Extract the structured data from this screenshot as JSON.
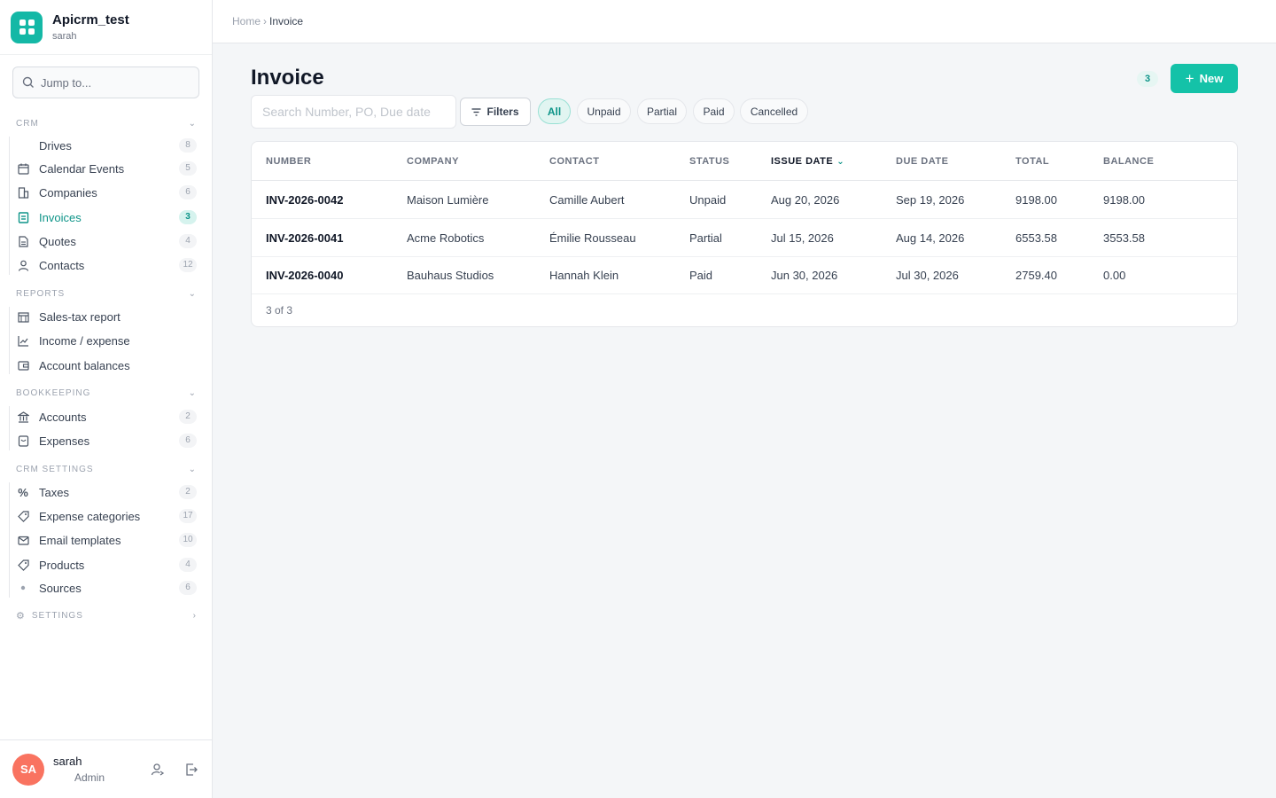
{
  "app": {
    "name": "Apicrm_test",
    "user": "sarah"
  },
  "search": {
    "placeholder": "Jump to..."
  },
  "sections": {
    "crm": "CRM",
    "reports": "REPORTS",
    "bookkeeping": "BOOKKEEPING",
    "crm_settings": "CRM SETTINGS",
    "settings": "SETTINGS"
  },
  "nav": {
    "crm": [
      {
        "label": "Drives",
        "count": "8"
      },
      {
        "label": "Calendar Events",
        "count": "5"
      },
      {
        "label": "Companies",
        "count": "6"
      },
      {
        "label": "Invoices",
        "count": "3"
      },
      {
        "label": "Quotes",
        "count": "4"
      },
      {
        "label": "Contacts",
        "count": "12"
      }
    ],
    "reports": [
      {
        "label": "Sales-tax report"
      },
      {
        "label": "Income / expense"
      },
      {
        "label": "Account balances"
      }
    ],
    "bookkeeping": [
      {
        "label": "Accounts",
        "count": "2"
      },
      {
        "label": "Expenses",
        "count": "6"
      }
    ],
    "crm_settings": [
      {
        "label": "Taxes",
        "count": "2"
      },
      {
        "label": "Expense categories",
        "count": "17"
      },
      {
        "label": "Email templates",
        "count": "10"
      },
      {
        "label": "Products",
        "count": "4"
      },
      {
        "label": "Sources",
        "count": "6"
      }
    ]
  },
  "footer": {
    "initials": "SA",
    "name": "sarah",
    "role": "Admin"
  },
  "breadcrumb": {
    "home": "Home",
    "separator": "›",
    "current": "Invoice"
  },
  "page": {
    "title": "Invoice",
    "count": "3",
    "new_label": "New"
  },
  "filters": {
    "search_placeholder": "Search Number, PO, Due date",
    "filters_label": "Filters",
    "chips": [
      "All",
      "Unpaid",
      "Partial",
      "Paid",
      "Cancelled"
    ],
    "active_chip": "All"
  },
  "table": {
    "columns": [
      "NUMBER",
      "COMPANY",
      "CONTACT",
      "STATUS",
      "ISSUE DATE",
      "DUE DATE",
      "TOTAL",
      "BALANCE"
    ],
    "sorted_column": "ISSUE DATE",
    "rows": [
      [
        "INV-2026-0042",
        "Maison Lumière",
        "Camille Aubert",
        "Unpaid",
        "Aug 20, 2026",
        "Sep 19, 2026",
        "9198.00",
        "9198.00"
      ],
      [
        "INV-2026-0041",
        "Acme Robotics",
        "Émilie Rousseau",
        "Partial",
        "Jul 15, 2026",
        "Aug 14, 2026",
        "6553.58",
        "3553.58"
      ],
      [
        "INV-2026-0040",
        "Bauhaus Studios",
        "Hannah Klein",
        "Paid",
        "Jun 30, 2026",
        "Jul 30, 2026",
        "2759.40",
        "0.00"
      ]
    ],
    "footer_text": "3 of 3"
  },
  "colors": {
    "accent": "#14c2a8",
    "accent_dark": "#0d9488",
    "avatar": "#f97360"
  }
}
